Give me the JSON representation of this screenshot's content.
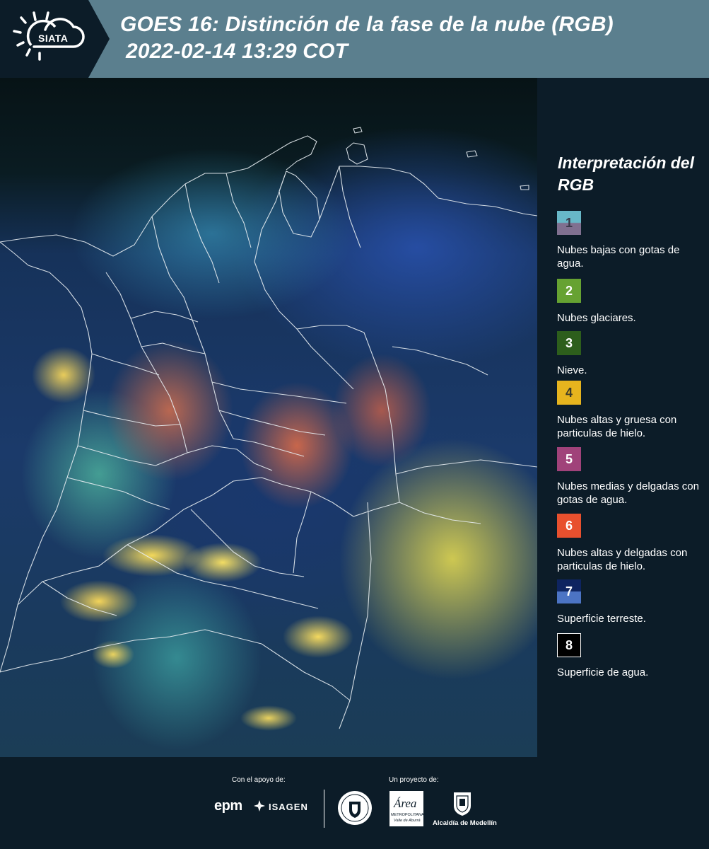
{
  "header": {
    "logo_text": "SIATA",
    "title_line1": "GOES 16: Distinción de la fase de la nube (RGB)",
    "title_line2": "2022-02-14 13:29 COT"
  },
  "legend": {
    "title": "Interpretación del RGB",
    "items": [
      {
        "number": "1",
        "description": "Nubes bajas con gotas de agua.",
        "colors": [
          "#68b8c8",
          "#807090"
        ]
      },
      {
        "number": "2",
        "description": "Nubes glaciares.",
        "colors": [
          "#66a232"
        ]
      },
      {
        "number": "3",
        "description": "Nieve.",
        "colors": [
          "#2d5e1c"
        ]
      },
      {
        "number": "4",
        "description": "Nubes altas y gruesa con particulas de hielo.",
        "colors": [
          "#e6b41e"
        ]
      },
      {
        "number": "5",
        "description": "Nubes medias y delgadas con gotas de agua.",
        "colors": [
          "#a0427a"
        ]
      },
      {
        "number": "6",
        "description": "Nubes altas y delgadas con particulas de hielo.",
        "colors": [
          "#e8502e"
        ]
      },
      {
        "number": "7",
        "description": "Superficie terreste.",
        "colors": [
          "#0e2460",
          "#4c74c4"
        ]
      },
      {
        "number": "8",
        "description": "Superficie de agua.",
        "colors": [
          "#000000"
        ]
      }
    ]
  },
  "footer": {
    "support_label": "Con el apoyo de:",
    "project_label": "Un proyecto de:",
    "epm_text": "epm",
    "isagen_text": "ISAGEN",
    "area_text": "Área",
    "area_sub1": "METROPOLITANA",
    "area_sub2": "Valle de Aburrá",
    "alcaldia_text": "Alcaldía de Medellín"
  },
  "colors": {
    "header_bg": "#5b7f8e",
    "page_bg": "#0c1c28"
  }
}
